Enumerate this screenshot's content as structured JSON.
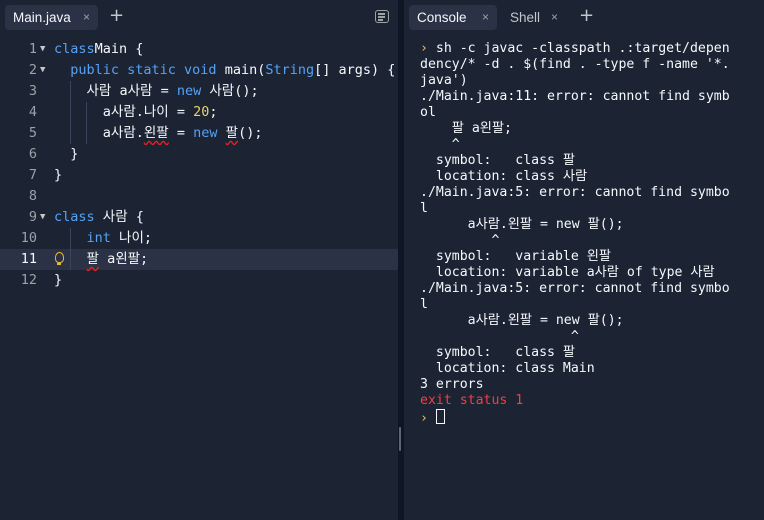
{
  "editor": {
    "tab_label": "Main.java",
    "close_glyph": "×",
    "add_tab_glyph": "+",
    "menu_icon": "panel-menu-icon",
    "lines": [
      {
        "num": "1",
        "fold": "▼",
        "segs": [
          [
            "kw",
            "class"
          ],
          [
            "",
            "Main {"
          ]
        ]
      },
      {
        "num": "2",
        "fold": "▼",
        "segs": [
          [
            "",
            "  "
          ],
          [
            "kw",
            "public static void"
          ],
          [
            "",
            " main("
          ],
          [
            "ty",
            "String"
          ],
          [
            "",
            "[] args) {"
          ]
        ]
      },
      {
        "num": "3",
        "segs": [
          [
            "",
            "    사람 a사람 = "
          ],
          [
            "kw",
            "new"
          ],
          [
            "",
            " 사람();"
          ]
        ]
      },
      {
        "num": "4",
        "segs": [
          [
            "",
            "      a사람.나이 = "
          ],
          [
            "num",
            "20"
          ],
          [
            "",
            ";"
          ]
        ]
      },
      {
        "num": "5",
        "segs": [
          [
            "",
            "      a사람."
          ],
          [
            "err",
            "왼팔"
          ],
          [
            "",
            " = "
          ],
          [
            "kw",
            "new"
          ],
          [
            "",
            " "
          ],
          [
            "err",
            "팔"
          ],
          [
            "",
            "();"
          ]
        ]
      },
      {
        "num": "6",
        "segs": [
          [
            "",
            "  }"
          ]
        ]
      },
      {
        "num": "7",
        "segs": [
          [
            "",
            "}"
          ]
        ]
      },
      {
        "num": "8",
        "segs": [
          [
            "",
            ""
          ]
        ]
      },
      {
        "num": "9",
        "fold": "▼",
        "segs": [
          [
            "kw",
            "class"
          ],
          [
            "",
            " 사람 {"
          ]
        ]
      },
      {
        "num": "10",
        "segs": [
          [
            "",
            "    "
          ],
          [
            "ty",
            "int"
          ],
          [
            "",
            " 나이;"
          ]
        ]
      },
      {
        "num": "11",
        "segs": [
          [
            "",
            "    "
          ],
          [
            "err",
            "팔"
          ],
          [
            "",
            " a왼팔;"
          ]
        ]
      },
      {
        "num": "12",
        "segs": [
          [
            "",
            "}"
          ]
        ]
      }
    ]
  },
  "console_panel": {
    "tabs": [
      {
        "label": "Console",
        "active": true
      },
      {
        "label": "Shell",
        "active": false
      }
    ],
    "close_glyph": "×",
    "add_tab_glyph": "+",
    "prompt_glyph": "›",
    "output": [
      {
        "p": true,
        "t": "sh -c javac -classpath .:target/depen"
      },
      {
        "t": "dency/* -d . $(find . -type f -name '*."
      },
      {
        "t": "java')"
      },
      {
        "t": "./Main.java:11: error: cannot find symb"
      },
      {
        "t": "ol"
      },
      {
        "t": "    팔 a왼팔;"
      },
      {
        "t": "    ^"
      },
      {
        "t": "  symbol:   class 팔"
      },
      {
        "t": "  location: class 사람"
      },
      {
        "t": "./Main.java:5: error: cannot find symbo"
      },
      {
        "t": "l"
      },
      {
        "t": "      a사람.왼팔 = new 팔();"
      },
      {
        "t": "         ^"
      },
      {
        "t": "  symbol:   variable 왼팔"
      },
      {
        "t": "  location: variable a사람 of type 사람"
      },
      {
        "t": "./Main.java:5: error: cannot find symbo"
      },
      {
        "t": "l"
      },
      {
        "t": "      a사람.왼팔 = new 팔();"
      },
      {
        "t": "                   ^"
      },
      {
        "t": "  symbol:   class 팔"
      },
      {
        "t": "  location: class Main"
      },
      {
        "t": "3 errors"
      },
      {
        "red": true,
        "t": "exit status 1"
      },
      {
        "p": true,
        "cursor": true,
        "t": ""
      }
    ]
  }
}
